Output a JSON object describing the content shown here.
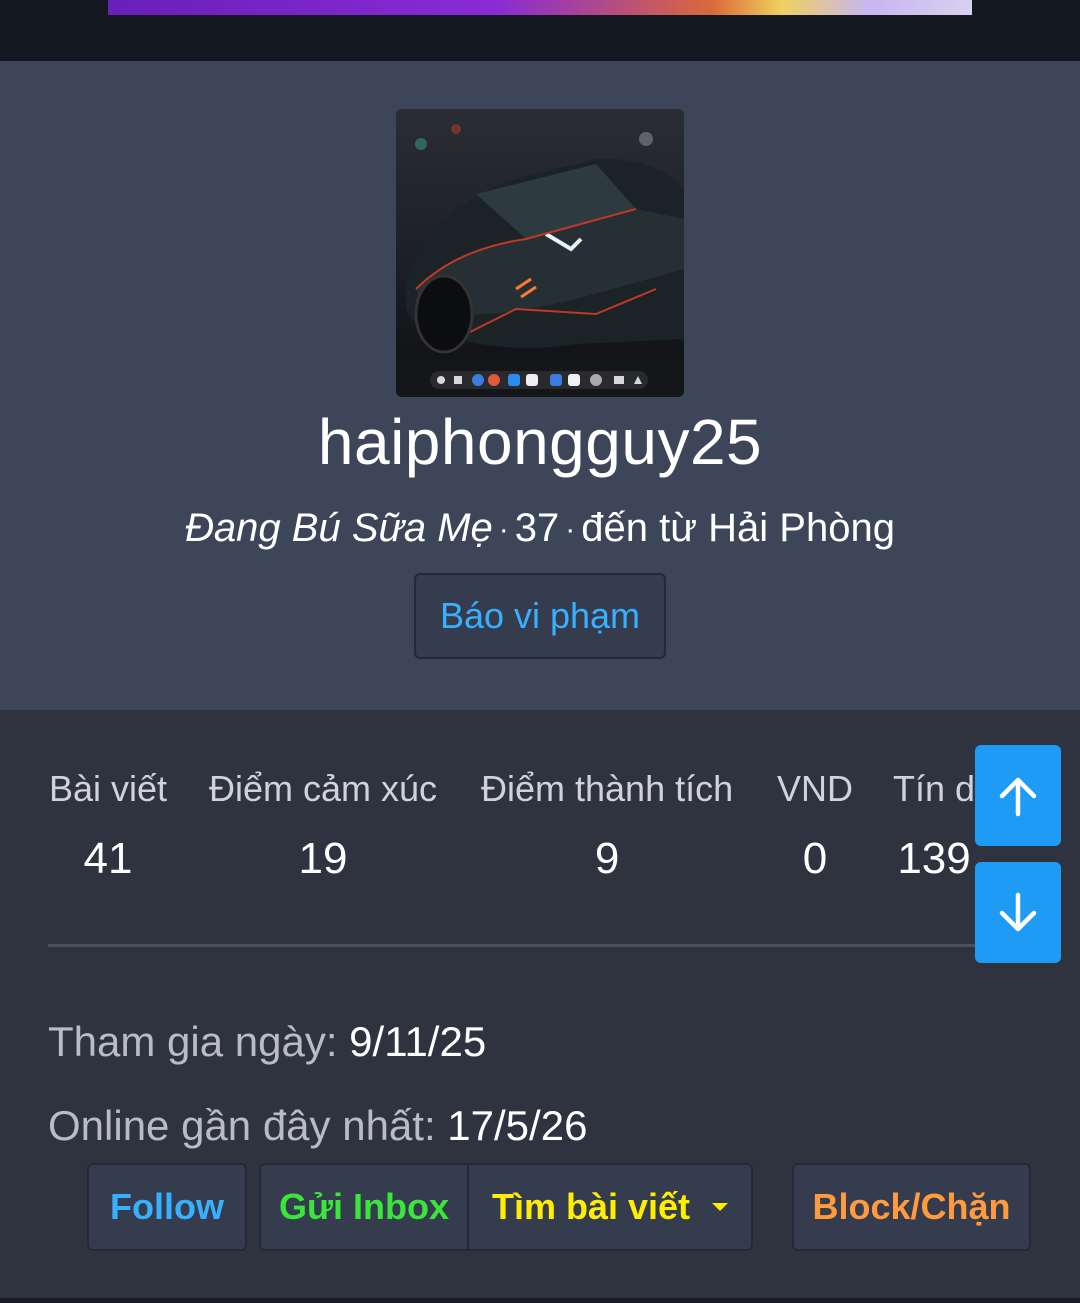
{
  "profile": {
    "username": "haiphongguy25",
    "title": "Đang Bú Sữa Mẹ",
    "separator": "·",
    "age": "37",
    "location": "đến từ Hải Phòng",
    "report_label": "Báo vi phạm"
  },
  "stats": [
    {
      "label": "Bài viết",
      "value": "41"
    },
    {
      "label": "Điểm cảm xúc",
      "value": "19"
    },
    {
      "label": "Điểm thành tích",
      "value": "9"
    },
    {
      "label": "VND",
      "value": "0"
    },
    {
      "label": "Tín d",
      "value": "139"
    }
  ],
  "info": {
    "joined_label": "Tham gia ngày:",
    "joined_value": "9/11/25",
    "online_label": "Online gần đây nhất:",
    "online_value": "17/5/26"
  },
  "actions": {
    "follow": "Follow",
    "inbox": "Gửi Inbox",
    "find_posts": "Tìm bài viết",
    "block": "Block/Chặn"
  },
  "icons": {
    "scroll_up": "arrow-up-icon",
    "scroll_down": "arrow-down-icon",
    "dropdown": "caret-down-icon"
  },
  "colors": {
    "link_blue": "#36b0ff",
    "inbox_green": "#39e639",
    "find_yellow": "#ffee00",
    "block_orange": "#ff9a3d",
    "scroll_button": "#1e9bf5"
  }
}
